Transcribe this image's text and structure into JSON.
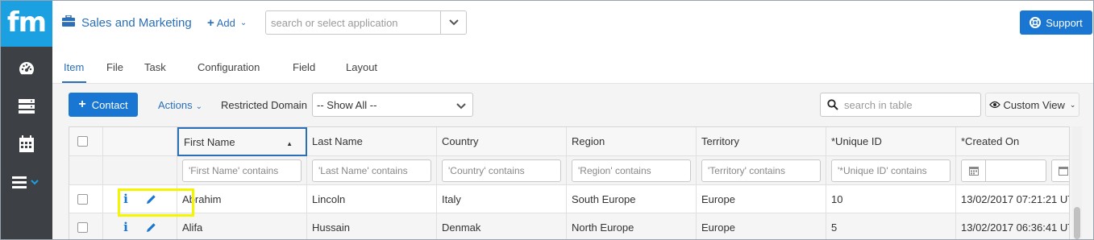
{
  "brand": {
    "logo_text": "fm"
  },
  "topbar": {
    "app_title": "Sales and Marketing",
    "add_label": "Add",
    "app_search_placeholder": "search or select application",
    "support_label": "Support"
  },
  "tabs": [
    {
      "label": "Item",
      "active": true
    },
    {
      "label": "File"
    },
    {
      "label": "Task"
    },
    {
      "label": "Configuration"
    },
    {
      "label": "Field"
    },
    {
      "label": "Layout"
    }
  ],
  "toolbar": {
    "contact_label": "Contact",
    "actions_label": "Actions",
    "restricted_domain_label": "Restricted Domain",
    "domain_value": "-- Show All --",
    "search_placeholder": "search in table",
    "custom_view_label": "Custom View"
  },
  "table": {
    "columns": [
      "First Name",
      "Last Name",
      "Country",
      "Region",
      "Territory",
      "*Unique ID",
      "*Created On"
    ],
    "filters": [
      "'First Name' contains",
      "'Last Name' contains",
      "'Country' contains",
      "'Region' contains",
      "'Territory' contains",
      "'*Unique ID' contains"
    ],
    "sorted_column": "First Name",
    "rows": [
      {
        "first": "Abrahim",
        "last": "Lincoln",
        "country": "Italy",
        "region": "South Europe",
        "territory": "Europe",
        "uid": "10",
        "created": "13/02/2017 07:21:21 UT"
      },
      {
        "first": "Alifa",
        "last": "Hussain",
        "country": "Denmak",
        "region": "North Europe",
        "territory": "Europe",
        "uid": "5",
        "created": "13/02/2017 06:36:41 UT"
      }
    ]
  },
  "colors": {
    "accent": "#1976d2",
    "logo_bg": "#1ba1e2",
    "sidebar_bg": "#3d4044",
    "highlight": "#f5f500"
  },
  "icons": [
    "dashboard-icon",
    "server-icon",
    "calendar-icon",
    "menu-icon",
    "briefcase-icon",
    "lifebuoy-icon",
    "search-icon",
    "eye-icon",
    "info-icon",
    "pencil-icon"
  ]
}
